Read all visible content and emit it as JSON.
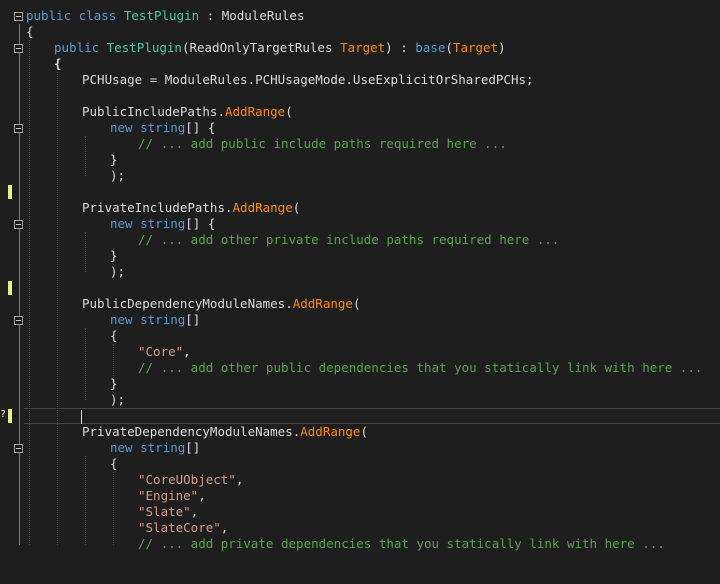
{
  "colors": {
    "background": "#1e1e1e",
    "keyword": "#569cd6",
    "type": "#4ec9b0",
    "method": "#ff8c00",
    "string": "#d69d85",
    "comment": "#57a64a",
    "plain": "#dcdcdc",
    "change_marker": "#efef8a"
  },
  "code": {
    "class_decl": {
      "kw_public": "public",
      "kw_class": "class",
      "name": "TestPlugin",
      "sep": " : ",
      "base": "ModuleRules"
    },
    "open_brace_1": "{",
    "ctor": {
      "kw_public": "public",
      "name": "TestPlugin",
      "paren": "(",
      "param_type": "ReadOnlyTargetRules",
      "param_name": "Target",
      "close": ") : ",
      "kw_base": "base",
      "base_open": "(",
      "base_arg": "Target",
      "base_close": ")"
    },
    "open_brace_2": "{",
    "pch_usage": "PCHUsage = ModuleRules.PCHUsageMode.UseExplicitOrSharedPCHs;",
    "public_include": {
      "target": "PublicIncludePaths.",
      "method": "AddRange",
      "paren": "("
    },
    "new_kw": "new",
    "string_type": "string",
    "array_open": "[] {",
    "array_open_bare": "[]",
    "brace_open": "{",
    "brace_close": "}",
    "close_call": ");",
    "comment_public_include": "// ... add public include paths required here ...",
    "private_include": {
      "target": "PrivateIncludePaths.",
      "method": "AddRange",
      "paren": "("
    },
    "comment_private_include": "// ... add other private include paths required here ...",
    "public_deps": {
      "target": "PublicDependencyModuleNames.",
      "method": "AddRange",
      "paren": "("
    },
    "str_core": "\"Core\"",
    "comma": ",",
    "comment_public_deps": "// ... add other public dependencies that you statically link with here ...",
    "private_deps": {
      "target": "PrivateDependencyModuleNames.",
      "method": "AddRange",
      "paren": "("
    },
    "str_coreuobject": "\"CoreUObject\"",
    "str_engine": "\"Engine\"",
    "str_slate": "\"Slate\"",
    "str_slatecore": "\"SlateCore\"",
    "comment_private_deps": "// ... add private dependencies that you statically link with here ..."
  },
  "gutter": {
    "error_glyph": "?"
  }
}
